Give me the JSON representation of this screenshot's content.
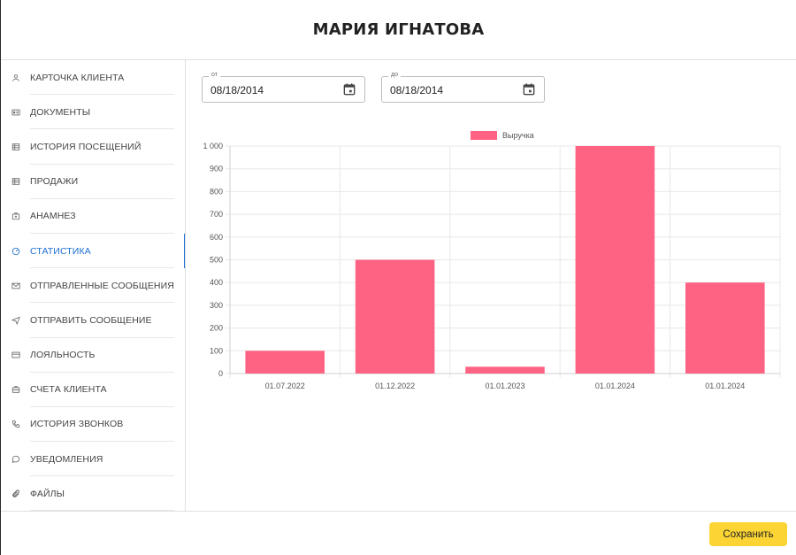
{
  "header": {
    "title": "МАРИЯ ИГНАТОВА"
  },
  "sidebar": {
    "items": [
      {
        "label": "КАРТОЧКА КЛИЕНТА",
        "icon": "user-icon",
        "active": false
      },
      {
        "label": "ДОКУМЕНТЫ",
        "icon": "id-card-icon",
        "active": false
      },
      {
        "label": "ИСТОРИЯ ПОСЕЩЕНИЙ",
        "icon": "table-icon",
        "active": false
      },
      {
        "label": "ПРОДАЖИ",
        "icon": "table-icon",
        "active": false
      },
      {
        "label": "АНАМНЕЗ",
        "icon": "medical-bag-icon",
        "active": false
      },
      {
        "label": "СТАТИСТИКА",
        "icon": "gauge-icon",
        "active": true
      },
      {
        "label": "ОТПРАВЛЕННЫЕ СООБЩЕНИЯ",
        "icon": "envelope-icon",
        "active": false
      },
      {
        "label": "ОТПРАВИТЬ СООБЩЕНИЕ",
        "icon": "paper-plane-icon",
        "active": false
      },
      {
        "label": "ЛОЯЛЬНОСТЬ",
        "icon": "credit-card-icon",
        "active": false
      },
      {
        "label": "СЧЕТА КЛИЕНТА",
        "icon": "briefcase-icon",
        "active": false
      },
      {
        "label": "ИСТОРИЯ ЗВОНКОВ",
        "icon": "phone-icon",
        "active": false
      },
      {
        "label": "УВЕДОМЛЕНИЯ",
        "icon": "chat-bubble-icon",
        "active": false
      },
      {
        "label": "ФАЙЛЫ",
        "icon": "paperclip-icon",
        "active": false
      }
    ],
    "active_color": "#1e6fd0"
  },
  "filters": {
    "from": {
      "legend": "от",
      "value": "08/18/2014"
    },
    "to": {
      "legend": "до",
      "value": "08/18/2014"
    }
  },
  "chart_data": {
    "type": "bar",
    "categories": [
      "01.07.2022",
      "01.12.2022",
      "01.01.2023",
      "01.01.2024",
      "01.01.2024"
    ],
    "series": [
      {
        "name": "Выручка",
        "values": [
          100,
          500,
          30,
          1000,
          400
        ],
        "color": "#ff6384"
      }
    ],
    "ylim": [
      0,
      1000
    ],
    "yticks": [
      0,
      100,
      200,
      300,
      400,
      500,
      600,
      700,
      800,
      900,
      1000
    ],
    "ytick_labels": [
      "0",
      "100",
      "200",
      "300",
      "400",
      "500",
      "600",
      "700",
      "800",
      "900",
      "1 000"
    ],
    "grid": true,
    "legend_position": "top-center",
    "title": "",
    "xlabel": "",
    "ylabel": ""
  },
  "footer": {
    "save_label": "Сохранить",
    "save_color": "#fcd535"
  }
}
